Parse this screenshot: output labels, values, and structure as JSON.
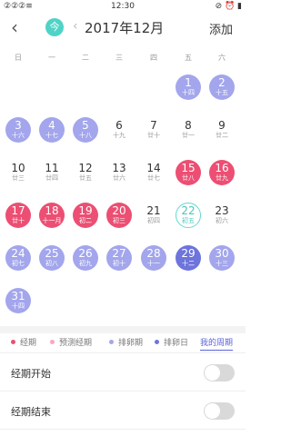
{
  "status_bar": {
    "signal": "②②②≡",
    "time": "12:30",
    "icons": "⊘ ⏰ ▮"
  },
  "header": {
    "back_icon": "‹",
    "today_label": "今",
    "prev_icon": "‹",
    "month": "2017年12月",
    "next_icon": "›",
    "add_label": "添加"
  },
  "weekdays": [
    "日",
    "一",
    "二",
    "三",
    "四",
    "五",
    "六"
  ],
  "days": [
    {
      "n": "1",
      "l": "十四",
      "t": "ovu"
    },
    {
      "n": "2",
      "l": "十五",
      "t": "ovu"
    },
    {
      "n": "3",
      "l": "十六",
      "t": "ovu"
    },
    {
      "n": "4",
      "l": "十七",
      "t": "ovu"
    },
    {
      "n": "5",
      "l": "十八",
      "t": "ovu"
    },
    {
      "n": "6",
      "l": "十九",
      "t": ""
    },
    {
      "n": "7",
      "l": "廿十",
      "t": ""
    },
    {
      "n": "8",
      "l": "廿一",
      "t": ""
    },
    {
      "n": "9",
      "l": "廿二",
      "t": ""
    },
    {
      "n": "10",
      "l": "廿三",
      "t": ""
    },
    {
      "n": "11",
      "l": "廿四",
      "t": ""
    },
    {
      "n": "12",
      "l": "廿五",
      "t": ""
    },
    {
      "n": "13",
      "l": "廿六",
      "t": ""
    },
    {
      "n": "14",
      "l": "廿七",
      "t": ""
    },
    {
      "n": "15",
      "l": "廿八",
      "t": "period"
    },
    {
      "n": "16",
      "l": "廿九",
      "t": "period"
    },
    {
      "n": "17",
      "l": "廿十",
      "t": "period"
    },
    {
      "n": "18",
      "l": "十一月",
      "t": "period"
    },
    {
      "n": "19",
      "l": "初二",
      "t": "period"
    },
    {
      "n": "20",
      "l": "初三",
      "t": "period"
    },
    {
      "n": "21",
      "l": "初四",
      "t": ""
    },
    {
      "n": "22",
      "l": "初五",
      "t": "today"
    },
    {
      "n": "23",
      "l": "初六",
      "t": ""
    },
    {
      "n": "24",
      "l": "初七",
      "t": "ovu"
    },
    {
      "n": "25",
      "l": "初八",
      "t": "ovu"
    },
    {
      "n": "26",
      "l": "初九",
      "t": "ovu"
    },
    {
      "n": "27",
      "l": "初十",
      "t": "ovu"
    },
    {
      "n": "28",
      "l": "十一",
      "t": "ovu"
    },
    {
      "n": "29",
      "l": "十二",
      "t": "ovuday"
    },
    {
      "n": "30",
      "l": "十三",
      "t": "ovu"
    },
    {
      "n": "31",
      "l": "十四",
      "t": "ovu"
    }
  ],
  "first_weekday": 5,
  "legend": {
    "period": "经期",
    "predicted": "预测经期",
    "ovulation": "排卵期",
    "ovulation_day": "排卵日",
    "my_cycle": "我的周期"
  },
  "colors": {
    "period": "#ec4f73",
    "predicted": "#f7a9bd",
    "ovulation": "#a3a6ec",
    "ovulation_day": "#6d74dc",
    "today_ring": "#63d9cd"
  },
  "settings": {
    "period_start": "经期开始",
    "period_end": "经期结束"
  }
}
